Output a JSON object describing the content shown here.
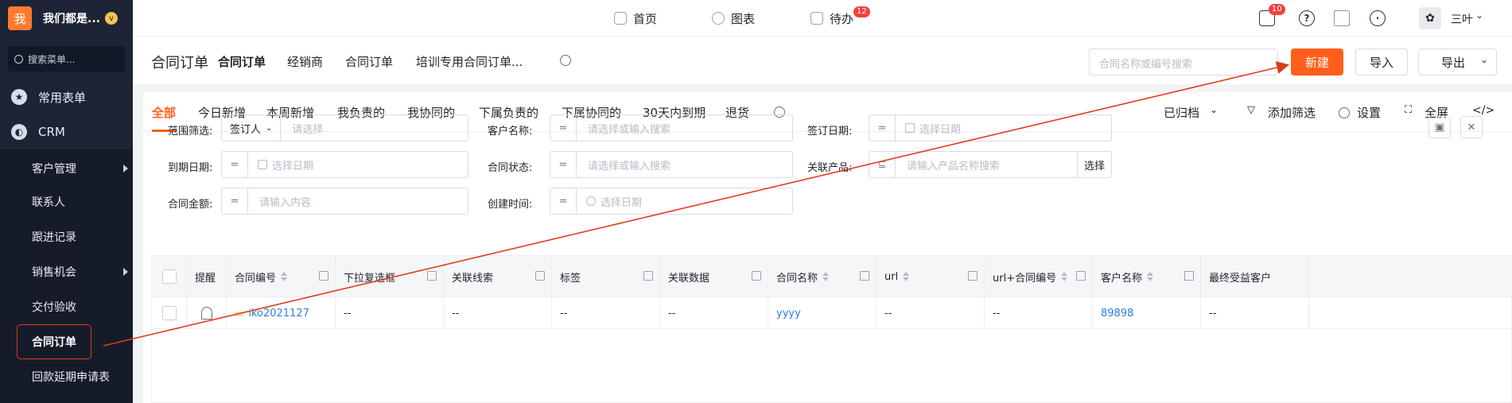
{
  "sidebar": {
    "logo_char": "我",
    "org_name": "我们都是...",
    "org_badge": "v",
    "search_label": "搜索菜单...",
    "sections": [
      {
        "label": "常用表单",
        "icon": "star-icon"
      },
      {
        "label": "CRM",
        "icon": "pie-chart-icon"
      }
    ],
    "items": [
      {
        "label": "客户管理",
        "has_arrow": true
      },
      {
        "label": "联系人"
      },
      {
        "label": "跟进记录"
      },
      {
        "label": "销售机会",
        "has_arrow": true
      },
      {
        "label": "交付验收"
      },
      {
        "label": "合同订单",
        "active": true
      },
      {
        "label": "回款延期申请表"
      }
    ]
  },
  "topbar": {
    "nav": [
      {
        "label": "首页",
        "icon": "home-icon"
      },
      {
        "label": "图表",
        "icon": "chart-icon"
      },
      {
        "label": "待办",
        "icon": "todo-icon",
        "badge": "12"
      }
    ],
    "message_badge": "10",
    "user_name": "三叶"
  },
  "subheader": {
    "title": "合同订单",
    "tabs": [
      "合同订单",
      "经销商",
      "合同订单",
      "培训专用合同订单..."
    ],
    "search_placeholder": "合同名称或编号搜索",
    "new_label": "新建",
    "import_label": "导入",
    "export_label": "导出"
  },
  "filter_tabs": {
    "items": [
      "全部",
      "今日新增",
      "本周新增",
      "我负责的",
      "我协同的",
      "下属负责的",
      "下属协同的",
      "30天内到期",
      "退货"
    ],
    "archived_label": "已归档",
    "add_filter_label": "添加筛选",
    "settings_label": "设置",
    "fullscreen_label": "全屏"
  },
  "filters": {
    "scope_label": "范围筛选:",
    "scope_select": "签订人",
    "scope_placeholder": "请选择",
    "customer_label": "客户名称:",
    "customer_placeholder": "请选择或输入搜索",
    "sign_date_label": "签订日期:",
    "date_placeholder": "选择日期",
    "due_date_label": "到期日期:",
    "status_label": "合同状态:",
    "status_placeholder": "请选择或输入搜索",
    "product_label": "关联产品:",
    "product_placeholder": "请输入产品名称搜索",
    "product_choose": "选择",
    "amount_label": "合同金额:",
    "amount_placeholder": "请输入内容",
    "created_label": "创建时间:",
    "op_eq": "=",
    "op_contains": "⊆"
  },
  "table": {
    "headers": [
      "提醒",
      "合同编号",
      "下拉复选框",
      "关联线索",
      "标签",
      "关联数据",
      "合同名称",
      "url",
      "url+合同编号",
      "客户名称",
      "最终受益客户"
    ],
    "rows": [
      [
        "",
        "iko2021127",
        "--",
        "--",
        "--",
        "--",
        "yyyy",
        "--",
        "--",
        "89898",
        "--"
      ]
    ]
  },
  "colors": {
    "accent": "#ff5f1a",
    "annotation": "#e03a1f",
    "sidebar_bg": "#1c2436",
    "link": "#2e7de1"
  }
}
